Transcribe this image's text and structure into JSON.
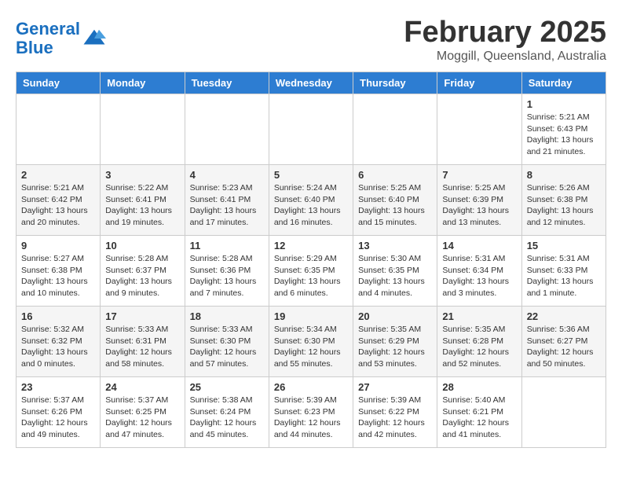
{
  "logo": {
    "line1": "General",
    "line2": "Blue"
  },
  "title": "February 2025",
  "subtitle": "Moggill, Queensland, Australia",
  "days_of_week": [
    "Sunday",
    "Monday",
    "Tuesday",
    "Wednesday",
    "Thursday",
    "Friday",
    "Saturday"
  ],
  "weeks": [
    [
      {
        "day": "",
        "info": ""
      },
      {
        "day": "",
        "info": ""
      },
      {
        "day": "",
        "info": ""
      },
      {
        "day": "",
        "info": ""
      },
      {
        "day": "",
        "info": ""
      },
      {
        "day": "",
        "info": ""
      },
      {
        "day": "1",
        "info": "Sunrise: 5:21 AM\nSunset: 6:43 PM\nDaylight: 13 hours\nand 21 minutes."
      }
    ],
    [
      {
        "day": "2",
        "info": "Sunrise: 5:21 AM\nSunset: 6:42 PM\nDaylight: 13 hours\nand 20 minutes."
      },
      {
        "day": "3",
        "info": "Sunrise: 5:22 AM\nSunset: 6:41 PM\nDaylight: 13 hours\nand 19 minutes."
      },
      {
        "day": "4",
        "info": "Sunrise: 5:23 AM\nSunset: 6:41 PM\nDaylight: 13 hours\nand 17 minutes."
      },
      {
        "day": "5",
        "info": "Sunrise: 5:24 AM\nSunset: 6:40 PM\nDaylight: 13 hours\nand 16 minutes."
      },
      {
        "day": "6",
        "info": "Sunrise: 5:25 AM\nSunset: 6:40 PM\nDaylight: 13 hours\nand 15 minutes."
      },
      {
        "day": "7",
        "info": "Sunrise: 5:25 AM\nSunset: 6:39 PM\nDaylight: 13 hours\nand 13 minutes."
      },
      {
        "day": "8",
        "info": "Sunrise: 5:26 AM\nSunset: 6:38 PM\nDaylight: 13 hours\nand 12 minutes."
      }
    ],
    [
      {
        "day": "9",
        "info": "Sunrise: 5:27 AM\nSunset: 6:38 PM\nDaylight: 13 hours\nand 10 minutes."
      },
      {
        "day": "10",
        "info": "Sunrise: 5:28 AM\nSunset: 6:37 PM\nDaylight: 13 hours\nand 9 minutes."
      },
      {
        "day": "11",
        "info": "Sunrise: 5:28 AM\nSunset: 6:36 PM\nDaylight: 13 hours\nand 7 minutes."
      },
      {
        "day": "12",
        "info": "Sunrise: 5:29 AM\nSunset: 6:35 PM\nDaylight: 13 hours\nand 6 minutes."
      },
      {
        "day": "13",
        "info": "Sunrise: 5:30 AM\nSunset: 6:35 PM\nDaylight: 13 hours\nand 4 minutes."
      },
      {
        "day": "14",
        "info": "Sunrise: 5:31 AM\nSunset: 6:34 PM\nDaylight: 13 hours\nand 3 minutes."
      },
      {
        "day": "15",
        "info": "Sunrise: 5:31 AM\nSunset: 6:33 PM\nDaylight: 13 hours\nand 1 minute."
      }
    ],
    [
      {
        "day": "16",
        "info": "Sunrise: 5:32 AM\nSunset: 6:32 PM\nDaylight: 13 hours\nand 0 minutes."
      },
      {
        "day": "17",
        "info": "Sunrise: 5:33 AM\nSunset: 6:31 PM\nDaylight: 12 hours\nand 58 minutes."
      },
      {
        "day": "18",
        "info": "Sunrise: 5:33 AM\nSunset: 6:30 PM\nDaylight: 12 hours\nand 57 minutes."
      },
      {
        "day": "19",
        "info": "Sunrise: 5:34 AM\nSunset: 6:30 PM\nDaylight: 12 hours\nand 55 minutes."
      },
      {
        "day": "20",
        "info": "Sunrise: 5:35 AM\nSunset: 6:29 PM\nDaylight: 12 hours\nand 53 minutes."
      },
      {
        "day": "21",
        "info": "Sunrise: 5:35 AM\nSunset: 6:28 PM\nDaylight: 12 hours\nand 52 minutes."
      },
      {
        "day": "22",
        "info": "Sunrise: 5:36 AM\nSunset: 6:27 PM\nDaylight: 12 hours\nand 50 minutes."
      }
    ],
    [
      {
        "day": "23",
        "info": "Sunrise: 5:37 AM\nSunset: 6:26 PM\nDaylight: 12 hours\nand 49 minutes."
      },
      {
        "day": "24",
        "info": "Sunrise: 5:37 AM\nSunset: 6:25 PM\nDaylight: 12 hours\nand 47 minutes."
      },
      {
        "day": "25",
        "info": "Sunrise: 5:38 AM\nSunset: 6:24 PM\nDaylight: 12 hours\nand 45 minutes."
      },
      {
        "day": "26",
        "info": "Sunrise: 5:39 AM\nSunset: 6:23 PM\nDaylight: 12 hours\nand 44 minutes."
      },
      {
        "day": "27",
        "info": "Sunrise: 5:39 AM\nSunset: 6:22 PM\nDaylight: 12 hours\nand 42 minutes."
      },
      {
        "day": "28",
        "info": "Sunrise: 5:40 AM\nSunset: 6:21 PM\nDaylight: 12 hours\nand 41 minutes."
      },
      {
        "day": "",
        "info": ""
      }
    ]
  ]
}
